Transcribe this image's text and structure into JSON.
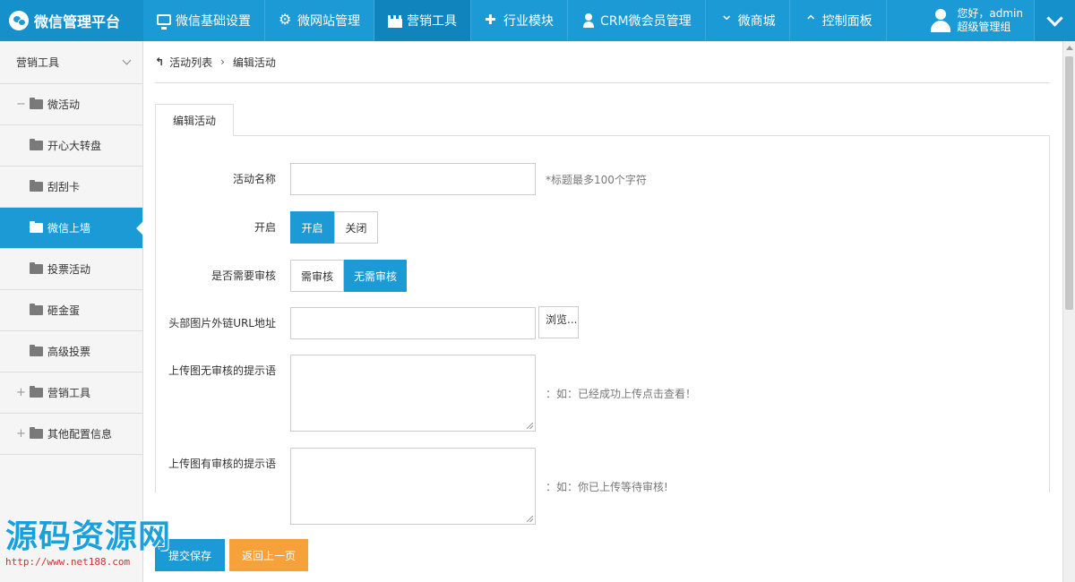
{
  "brand": {
    "title": "微信管理平台"
  },
  "nav": [
    {
      "label": "微信基础设置",
      "icon": "monitor-icon"
    },
    {
      "label": "微网站管理",
      "icon": "gear-icon"
    },
    {
      "label": "营销工具",
      "icon": "castle-icon",
      "active": true
    },
    {
      "label": "行业模块",
      "icon": "puzzle-icon"
    },
    {
      "label": "CRM微会员管理",
      "icon": "user-icon"
    },
    {
      "label": "微商城",
      "icon": "chevron-down-icon"
    },
    {
      "label": "控制面板",
      "icon": "chevron-up-icon"
    }
  ],
  "user": {
    "greeting": "您好，admin",
    "role": "超级管理组"
  },
  "sidebar": {
    "header": "营销工具",
    "group_open": "微活动",
    "items": [
      "开心大转盘",
      "刮刮卡",
      "微信上墙",
      "投票活动",
      "砸金蛋",
      "高级投票"
    ],
    "active_item": "微信上墙",
    "groups_closed": [
      "营销工具",
      "其他配置信息"
    ]
  },
  "breadcrumb": {
    "back": "↰",
    "list": "活动列表",
    "sep": "›",
    "current": "编辑活动"
  },
  "tab": {
    "label": "编辑活动"
  },
  "form": {
    "name_label": "活动名称",
    "name_value": "",
    "name_hint": "*标题最多100个字符",
    "open_label": "开启",
    "open_on": "开启",
    "open_off": "关闭",
    "review_label": "是否需要审核",
    "review_yes": "需审核",
    "review_no": "无需审核",
    "header_img_label": "头部图片外链URL地址",
    "header_img_value": "",
    "browse_label": "浏览...",
    "no_review_label": "上传图无审核的提示语",
    "no_review_hint": "：如：已经成功上传点击查看！",
    "review_tip_label": "上传图有审核的提示语",
    "review_tip_hint": "：如：你已上传等待审核!"
  },
  "actions": {
    "save": "提交保存",
    "back": "返回上一页"
  },
  "watermark": {
    "text": "源码资源网",
    "url": "http://www.net188.com"
  },
  "colors": {
    "primary": "#1c9ad6",
    "warning": "#f6a13a"
  }
}
